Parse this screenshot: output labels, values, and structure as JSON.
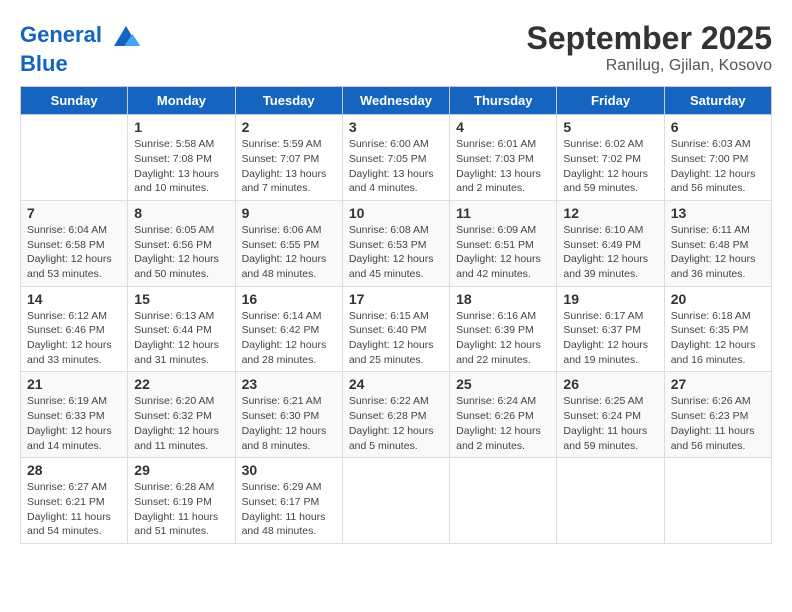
{
  "header": {
    "logo_line1": "General",
    "logo_line2": "Blue",
    "title": "September 2025",
    "subtitle": "Ranilug, Gjilan, Kosovo"
  },
  "days_of_week": [
    "Sunday",
    "Monday",
    "Tuesday",
    "Wednesday",
    "Thursday",
    "Friday",
    "Saturday"
  ],
  "weeks": [
    [
      {
        "day": "",
        "info": ""
      },
      {
        "day": "1",
        "info": "Sunrise: 5:58 AM\nSunset: 7:08 PM\nDaylight: 13 hours and 10 minutes."
      },
      {
        "day": "2",
        "info": "Sunrise: 5:59 AM\nSunset: 7:07 PM\nDaylight: 13 hours and 7 minutes."
      },
      {
        "day": "3",
        "info": "Sunrise: 6:00 AM\nSunset: 7:05 PM\nDaylight: 13 hours and 4 minutes."
      },
      {
        "day": "4",
        "info": "Sunrise: 6:01 AM\nSunset: 7:03 PM\nDaylight: 13 hours and 2 minutes."
      },
      {
        "day": "5",
        "info": "Sunrise: 6:02 AM\nSunset: 7:02 PM\nDaylight: 12 hours and 59 minutes."
      },
      {
        "day": "6",
        "info": "Sunrise: 6:03 AM\nSunset: 7:00 PM\nDaylight: 12 hours and 56 minutes."
      }
    ],
    [
      {
        "day": "7",
        "info": "Sunrise: 6:04 AM\nSunset: 6:58 PM\nDaylight: 12 hours and 53 minutes."
      },
      {
        "day": "8",
        "info": "Sunrise: 6:05 AM\nSunset: 6:56 PM\nDaylight: 12 hours and 50 minutes."
      },
      {
        "day": "9",
        "info": "Sunrise: 6:06 AM\nSunset: 6:55 PM\nDaylight: 12 hours and 48 minutes."
      },
      {
        "day": "10",
        "info": "Sunrise: 6:08 AM\nSunset: 6:53 PM\nDaylight: 12 hours and 45 minutes."
      },
      {
        "day": "11",
        "info": "Sunrise: 6:09 AM\nSunset: 6:51 PM\nDaylight: 12 hours and 42 minutes."
      },
      {
        "day": "12",
        "info": "Sunrise: 6:10 AM\nSunset: 6:49 PM\nDaylight: 12 hours and 39 minutes."
      },
      {
        "day": "13",
        "info": "Sunrise: 6:11 AM\nSunset: 6:48 PM\nDaylight: 12 hours and 36 minutes."
      }
    ],
    [
      {
        "day": "14",
        "info": "Sunrise: 6:12 AM\nSunset: 6:46 PM\nDaylight: 12 hours and 33 minutes."
      },
      {
        "day": "15",
        "info": "Sunrise: 6:13 AM\nSunset: 6:44 PM\nDaylight: 12 hours and 31 minutes."
      },
      {
        "day": "16",
        "info": "Sunrise: 6:14 AM\nSunset: 6:42 PM\nDaylight: 12 hours and 28 minutes."
      },
      {
        "day": "17",
        "info": "Sunrise: 6:15 AM\nSunset: 6:40 PM\nDaylight: 12 hours and 25 minutes."
      },
      {
        "day": "18",
        "info": "Sunrise: 6:16 AM\nSunset: 6:39 PM\nDaylight: 12 hours and 22 minutes."
      },
      {
        "day": "19",
        "info": "Sunrise: 6:17 AM\nSunset: 6:37 PM\nDaylight: 12 hours and 19 minutes."
      },
      {
        "day": "20",
        "info": "Sunrise: 6:18 AM\nSunset: 6:35 PM\nDaylight: 12 hours and 16 minutes."
      }
    ],
    [
      {
        "day": "21",
        "info": "Sunrise: 6:19 AM\nSunset: 6:33 PM\nDaylight: 12 hours and 14 minutes."
      },
      {
        "day": "22",
        "info": "Sunrise: 6:20 AM\nSunset: 6:32 PM\nDaylight: 12 hours and 11 minutes."
      },
      {
        "day": "23",
        "info": "Sunrise: 6:21 AM\nSunset: 6:30 PM\nDaylight: 12 hours and 8 minutes."
      },
      {
        "day": "24",
        "info": "Sunrise: 6:22 AM\nSunset: 6:28 PM\nDaylight: 12 hours and 5 minutes."
      },
      {
        "day": "25",
        "info": "Sunrise: 6:24 AM\nSunset: 6:26 PM\nDaylight: 12 hours and 2 minutes."
      },
      {
        "day": "26",
        "info": "Sunrise: 6:25 AM\nSunset: 6:24 PM\nDaylight: 11 hours and 59 minutes."
      },
      {
        "day": "27",
        "info": "Sunrise: 6:26 AM\nSunset: 6:23 PM\nDaylight: 11 hours and 56 minutes."
      }
    ],
    [
      {
        "day": "28",
        "info": "Sunrise: 6:27 AM\nSunset: 6:21 PM\nDaylight: 11 hours and 54 minutes."
      },
      {
        "day": "29",
        "info": "Sunrise: 6:28 AM\nSunset: 6:19 PM\nDaylight: 11 hours and 51 minutes."
      },
      {
        "day": "30",
        "info": "Sunrise: 6:29 AM\nSunset: 6:17 PM\nDaylight: 11 hours and 48 minutes."
      },
      {
        "day": "",
        "info": ""
      },
      {
        "day": "",
        "info": ""
      },
      {
        "day": "",
        "info": ""
      },
      {
        "day": "",
        "info": ""
      }
    ]
  ]
}
